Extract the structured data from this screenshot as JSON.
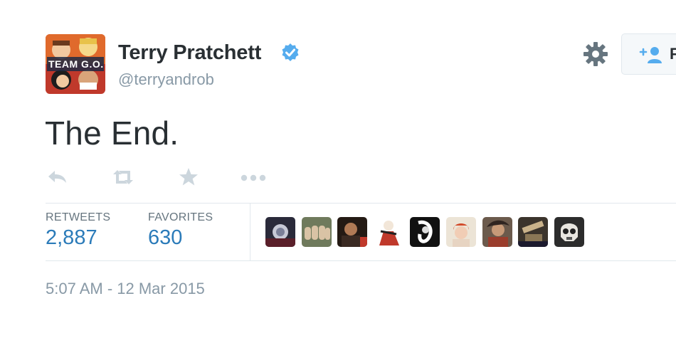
{
  "profile": {
    "display_name": "Terry Pratchett",
    "handle": "@terryandrob",
    "verified": true,
    "avatar_text": "TEAM G.O."
  },
  "header": {
    "settings_icon": "gear-icon",
    "follow_label": "F"
  },
  "tweet": {
    "text": "The End."
  },
  "actions": [
    {
      "name": "reply",
      "icon": "reply-icon"
    },
    {
      "name": "retweet",
      "icon": "retweet-icon"
    },
    {
      "name": "favorite",
      "icon": "star-icon"
    },
    {
      "name": "more",
      "icon": "more-icon"
    }
  ],
  "stats": {
    "retweets_label": "RETWEETS",
    "retweets_value": "2,887",
    "favorites_label": "FAVORITES",
    "favorites_value": "630"
  },
  "favorited_by_count": 9,
  "timestamp": "5:07 AM - 12 Mar 2015",
  "colors": {
    "link": "#2b7bb9",
    "verified": "#55acee",
    "muted": "#8899a6",
    "icon": "#ccd6dd",
    "border": "#e1e8ed"
  }
}
